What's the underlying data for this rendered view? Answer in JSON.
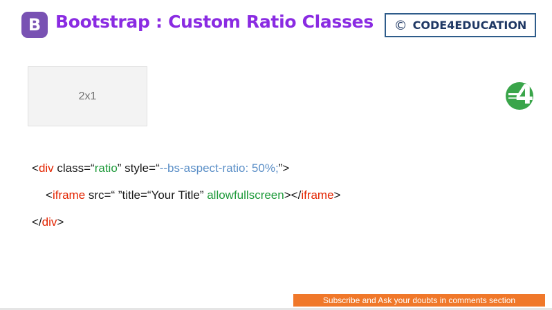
{
  "header": {
    "logo_letter": "B",
    "title": "Bootstrap : Custom Ratio Classes",
    "copyright_symbol": "©",
    "brand": "CODE4EDUCATION",
    "title_color": "#8a2be2",
    "logo_color": "#7952b3"
  },
  "demo": {
    "ratio_label": "2x1"
  },
  "side_logo": {
    "glyph": "4",
    "icon": "code4education-logo-icon",
    "color": "#3aa54a"
  },
  "code": {
    "line1": {
      "open_lt": "<",
      "tag": "div",
      "class_attr": " class=“",
      "class_val": "ratio",
      "style_attr": "” style=“",
      "style_val": "--bs-aspect-ratio: 50%;",
      "close": "”>"
    },
    "line2": {
      "open_lt": "<",
      "tag": "iframe",
      "attrs": " src=“ ”title=“Your Title” ",
      "allow": "allowfullscreen",
      "mid": "></",
      "close_tag": "iframe",
      "close": ">"
    },
    "line3": {
      "open": "</",
      "tag": "div",
      "close": ">"
    }
  },
  "footer": {
    "banner": "Subscribe and Ask your doubts in comments section",
    "banner_color": "#f0782a"
  }
}
